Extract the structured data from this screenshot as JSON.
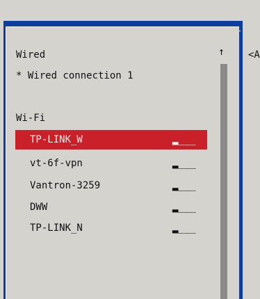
{
  "sections": {
    "wired_heading": "Wired",
    "wired_connection": "* Wired connection 1",
    "wifi_heading": "Wi-Fi"
  },
  "networks": [
    {
      "name": "TP-LINK_W",
      "signal": "▂___",
      "selected": true
    },
    {
      "name": "vt-6f-vpn",
      "signal": "▂___",
      "selected": false
    },
    {
      "name": "Vantron-3259",
      "signal": "▂___",
      "selected": false
    },
    {
      "name": "DWW",
      "signal": "▂___",
      "selected": false
    },
    {
      "name": "TP-LINK_N",
      "signal": "▂___",
      "selected": false
    }
  ],
  "scrollbar": {
    "up_arrow": "↑"
  },
  "side_panel": {
    "partial_text": "<A"
  },
  "colors": {
    "background": "#d5d3ce",
    "window_frame": "#0e3da0",
    "selection": "#c9202a",
    "scroll_track": "#8a8a8a"
  }
}
